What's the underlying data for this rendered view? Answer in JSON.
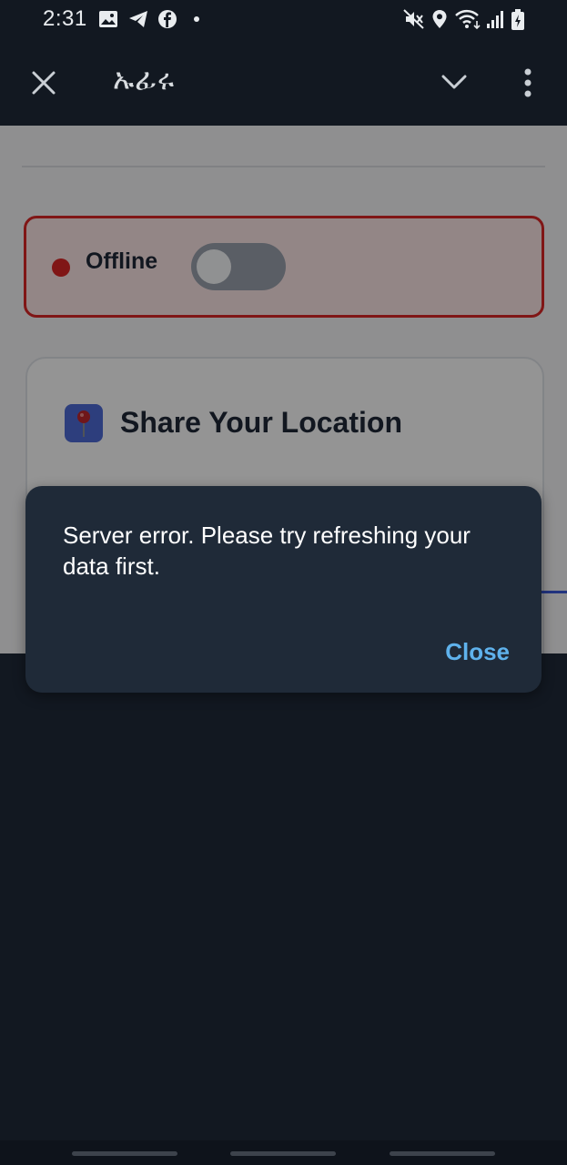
{
  "status_bar": {
    "time": "2:31",
    "left_icons": [
      "gallery-icon",
      "telegram-icon",
      "facebook-icon",
      "dot-icon"
    ],
    "right_icons": [
      "mute-icon",
      "location-icon",
      "wifi-icon",
      "signal-icon",
      "battery-icon"
    ]
  },
  "app_bar": {
    "title": "ኡፊሩ",
    "close_icon": "close-icon",
    "chevron_icon": "chevron-down-icon",
    "menu_icon": "more-vert-icon"
  },
  "content": {
    "status_card": {
      "label": "Offline",
      "toggle_on": false,
      "accent": "#dc2626"
    },
    "location_card": {
      "icon": "pin-icon",
      "title": "Share Your Location"
    }
  },
  "dialog": {
    "message": "Server error. Please try refreshing your data first.",
    "close_label": "Close",
    "accent": "#5fb2ec"
  }
}
